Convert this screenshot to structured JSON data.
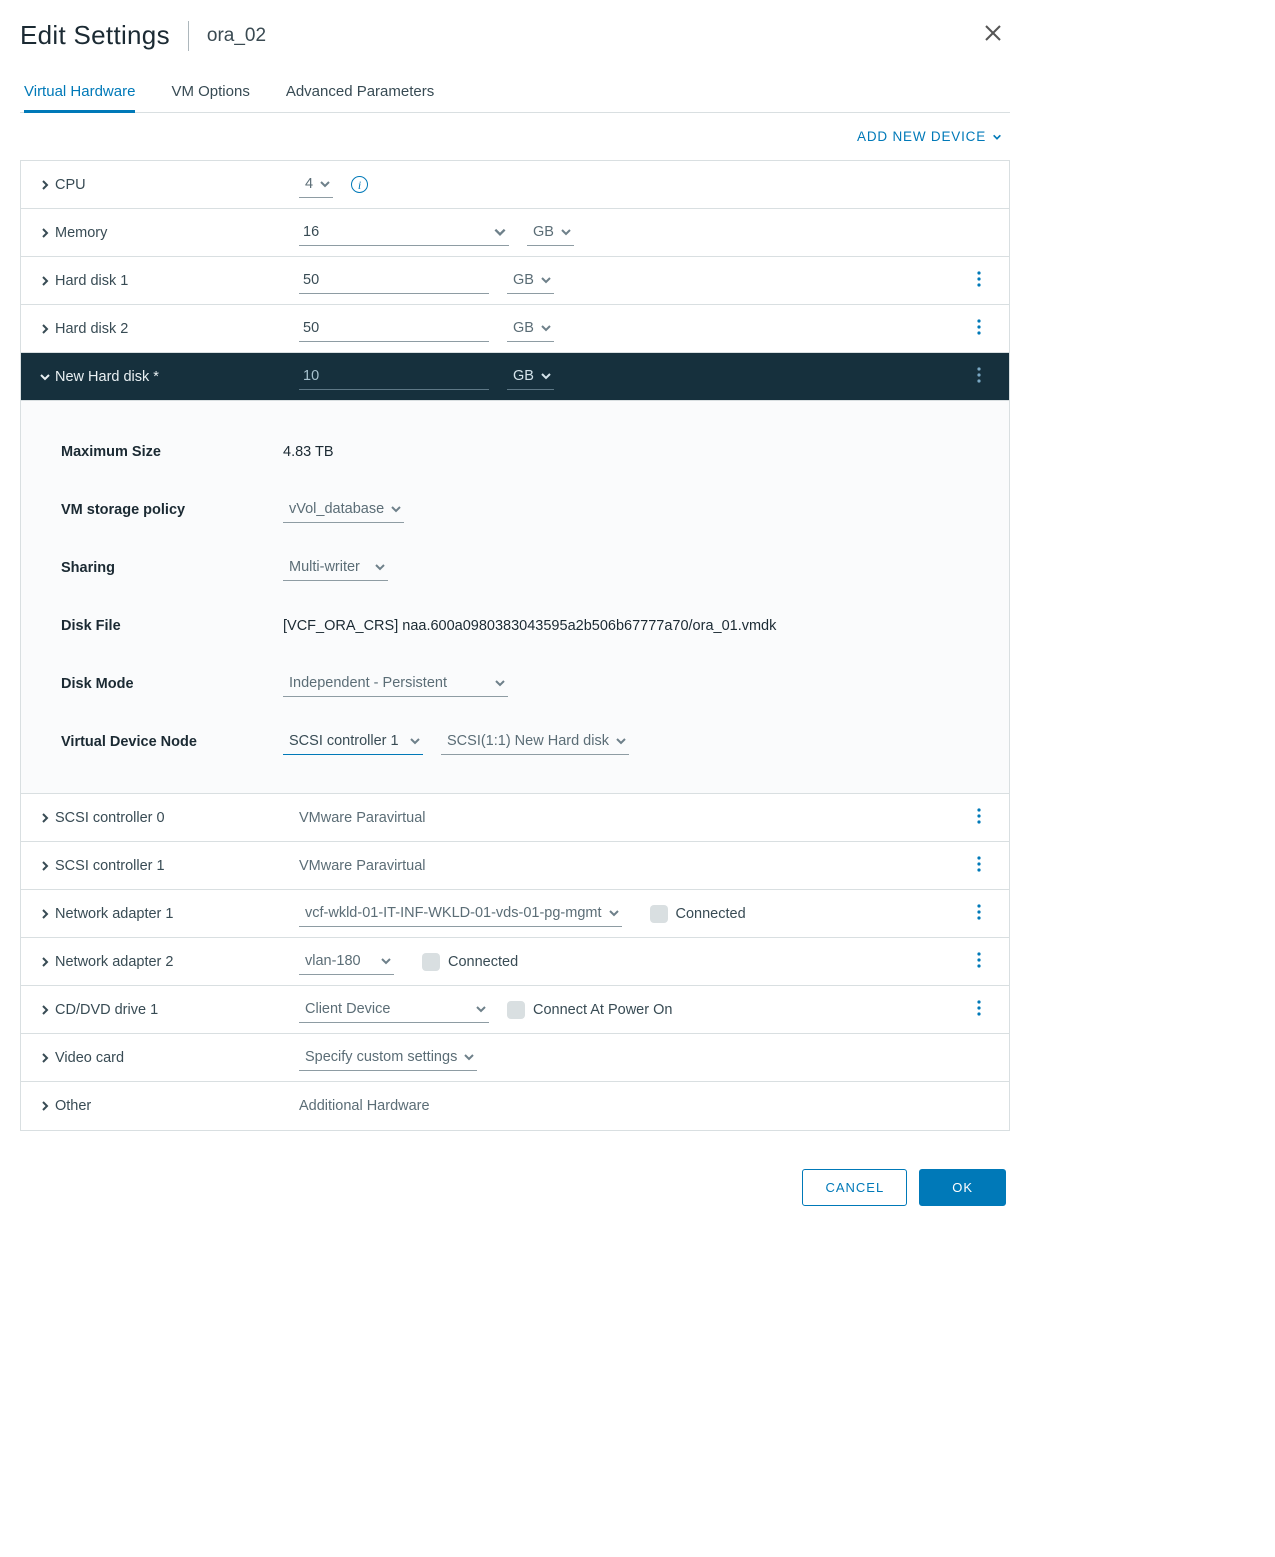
{
  "header": {
    "title": "Edit Settings",
    "vm": "ora_02"
  },
  "tabs": {
    "t0": "Virtual Hardware",
    "t1": "VM Options",
    "t2": "Advanced Parameters"
  },
  "addNew": "ADD NEW DEVICE",
  "rows": {
    "cpu": {
      "label": "CPU",
      "value": "4"
    },
    "memory": {
      "label": "Memory",
      "value": "16",
      "unit": "GB"
    },
    "hd1": {
      "label": "Hard disk 1",
      "value": "50",
      "unit": "GB"
    },
    "hd2": {
      "label": "Hard disk 2",
      "value": "50",
      "unit": "GB"
    },
    "newhd": {
      "label": "New Hard disk *",
      "value": "10",
      "unit": "GB"
    },
    "scsi0": {
      "label": "SCSI controller 0",
      "value": "VMware Paravirtual"
    },
    "scsi1": {
      "label": "SCSI controller 1",
      "value": "VMware Paravirtual"
    },
    "net1": {
      "label": "Network adapter 1",
      "value": "vcf-wkld-01-IT-INF-WKLD-01-vds-01-pg-mgmt",
      "chk": "Connected"
    },
    "net2": {
      "label": "Network adapter 2",
      "value": "vlan-180",
      "chk": "Connected"
    },
    "cd": {
      "label": "CD/DVD drive 1",
      "value": "Client Device",
      "chk": "Connect At Power On"
    },
    "video": {
      "label": "Video card",
      "value": "Specify custom settings"
    },
    "other": {
      "label": "Other",
      "value": "Additional Hardware"
    }
  },
  "expanded": {
    "maxSize": {
      "label": "Maximum Size",
      "value": "4.83 TB"
    },
    "policy": {
      "label": "VM storage policy",
      "value": "vVol_database"
    },
    "sharing": {
      "label": "Sharing",
      "value": "Multi-writer"
    },
    "diskFile": {
      "label": "Disk File",
      "value": "[VCF_ORA_CRS] naa.600a0980383043595a2b506b67777a70/ora_01.vmdk"
    },
    "diskMode": {
      "label": "Disk Mode",
      "value": "Independent - Persistent"
    },
    "vdn": {
      "label": "Virtual Device Node",
      "ctrl": "SCSI controller 1",
      "slot": "SCSI(1:1) New Hard disk"
    }
  },
  "footer": {
    "cancel": "CANCEL",
    "ok": "OK"
  }
}
